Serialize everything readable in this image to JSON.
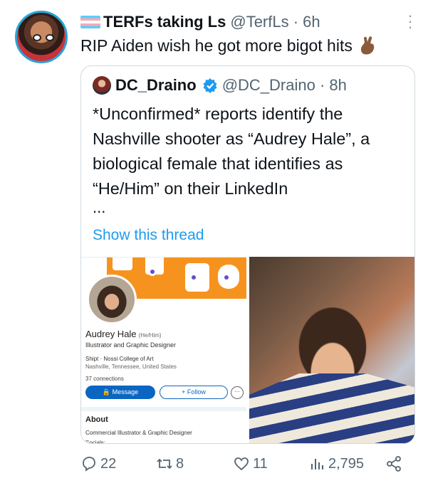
{
  "tweet": {
    "author_name": "TERFs taking Ls",
    "author_handle": "@TerfLs",
    "time": "6h",
    "text": "RIP Aiden wish he got more bigot hits"
  },
  "quote": {
    "author_name": "DC_Draino",
    "author_handle": "@DC_Draino",
    "time": "8h",
    "text": "*Unconfirmed* reports identify the Nashville shooter as “Audrey Hale”, a biological female that identifies as “He/Him” on their LinkedIn",
    "ellipsis": "...",
    "show_thread": "Show this thread"
  },
  "linkedin": {
    "name": "Audrey Hale",
    "pronouns": "(He/Him)",
    "headline": "Illustrator and Graphic Designer",
    "company": "Shipt · Nossi College of Art",
    "location": "Nashville, Tennessee, United States",
    "connections": "37 connections",
    "message_label": "Message",
    "follow_label": "+ Follow",
    "more_label": "···",
    "about_heading": "About",
    "about_text": "Commercial Illustrator & Graphic Designer",
    "socials": "Socials:"
  },
  "actions": {
    "replies": "22",
    "retweets": "8",
    "likes": "11",
    "views": "2,795"
  },
  "colors": {
    "link": "#1d9bf0",
    "muted": "#536471",
    "linkedin_blue": "#0a66c2",
    "banner_orange": "#f6931e"
  }
}
